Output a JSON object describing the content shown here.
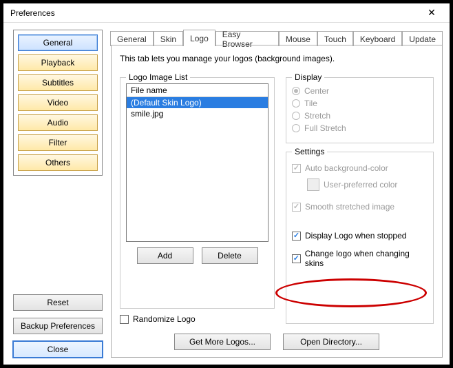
{
  "window": {
    "title": "Preferences"
  },
  "sidebar": {
    "categories": [
      {
        "label": "General"
      },
      {
        "label": "Playback"
      },
      {
        "label": "Subtitles"
      },
      {
        "label": "Video"
      },
      {
        "label": "Audio"
      },
      {
        "label": "Filter"
      },
      {
        "label": "Others"
      }
    ],
    "buttons": {
      "reset": "Reset",
      "backup": "Backup Preferences",
      "close": "Close"
    }
  },
  "tabs": [
    {
      "label": "General"
    },
    {
      "label": "Skin"
    },
    {
      "label": "Logo"
    },
    {
      "label": "Easy Browser"
    },
    {
      "label": "Mouse"
    },
    {
      "label": "Touch"
    },
    {
      "label": "Keyboard"
    },
    {
      "label": "Update"
    }
  ],
  "logoTab": {
    "description": "This tab lets you manage your logos (background images).",
    "listGroup": {
      "legend": "Logo Image List",
      "header": "File name",
      "items": [
        {
          "text": "(Default Skin Logo)",
          "selected": true
        },
        {
          "text": "smile.jpg",
          "selected": false
        }
      ],
      "add": "Add",
      "delete": "Delete",
      "randomize": "Randomize Logo"
    },
    "displayGroup": {
      "legend": "Display",
      "options": {
        "center": "Center",
        "tile": "Tile",
        "stretch": "Stretch",
        "full": "Full Stretch"
      }
    },
    "settingsGroup": {
      "legend": "Settings",
      "autoBg": "Auto background-color",
      "userColor": "User-preferred color",
      "smooth": "Smooth stretched image",
      "displayWhenStopped": "Display Logo when stopped",
      "changeOnSkin": "Change logo when changing skins"
    },
    "bottom": {
      "getMore": "Get More Logos...",
      "openDir": "Open Directory..."
    }
  }
}
